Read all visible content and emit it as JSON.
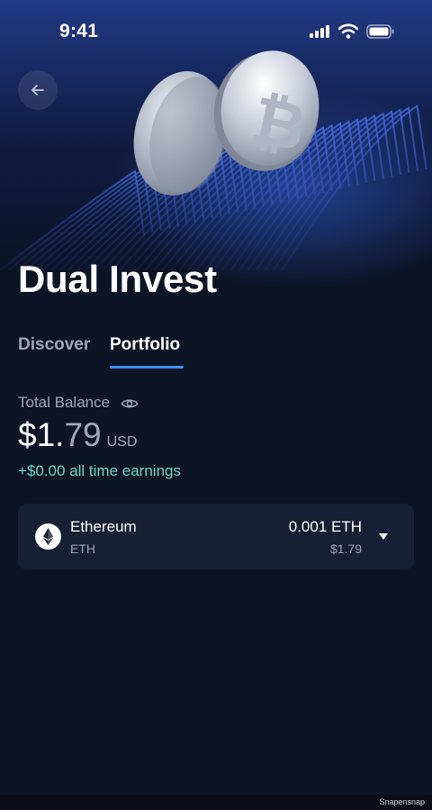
{
  "status_bar": {
    "time": "9:41"
  },
  "header": {
    "title": "Dual Invest"
  },
  "tabs": [
    {
      "label": "Discover",
      "active": false
    },
    {
      "label": "Portfolio",
      "active": true
    }
  ],
  "balance": {
    "label": "Total Balance",
    "amount_main": "$1.",
    "amount_decimal": "79",
    "currency": "USD",
    "earnings": "+$0.00 all time earnings"
  },
  "assets": [
    {
      "name": "Ethereum",
      "symbol": "ETH",
      "amount": "0.001 ETH",
      "value": "$1.79",
      "icon": "ethereum-icon"
    }
  ],
  "footer": {
    "watermark": "Snapensnap"
  },
  "colors": {
    "background": "#0d1426",
    "accent": "#3b8ef0",
    "earnings_green": "#6fd6c3",
    "card": "#161f33",
    "muted_text": "#9ea6b8"
  },
  "icons": [
    "back-arrow-icon",
    "eye-icon",
    "ethereum-icon",
    "dropdown-caret-icon",
    "signal-icon",
    "wifi-icon",
    "battery-icon"
  ]
}
